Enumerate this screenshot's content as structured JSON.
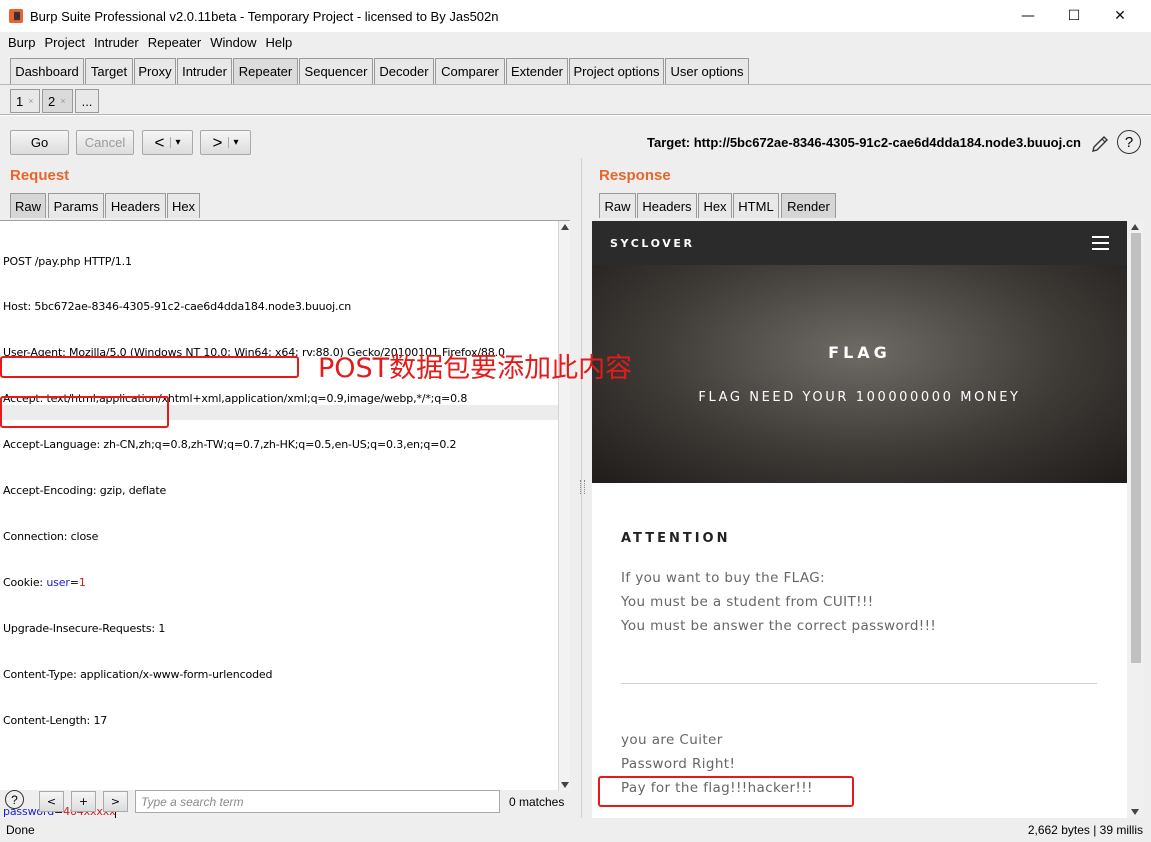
{
  "window": {
    "title": "Burp Suite Professional v2.0.11beta - Temporary Project - licensed to By Jas502n",
    "minimize": "—",
    "maximize": "☐",
    "close": "✕"
  },
  "menu": [
    "Burp",
    "Project",
    "Intruder",
    "Repeater",
    "Window",
    "Help"
  ],
  "main_tabs": [
    "Dashboard",
    "Target",
    "Proxy",
    "Intruder",
    "Repeater",
    "Sequencer",
    "Decoder",
    "Comparer",
    "Extender",
    "Project options",
    "User options"
  ],
  "active_main_tab": "Repeater",
  "sub_tabs": {
    "tab1": "1",
    "tab2": "2",
    "more": "...",
    "close_glyph": "×"
  },
  "toolbar": {
    "go": "Go",
    "cancel": "Cancel",
    "back": "<",
    "back_drop": "▾",
    "forward": ">",
    "forward_drop": "▾",
    "target": "Target: http://5bc672ae-8346-4305-91c2-cae6d4dda184.node3.buuoj.cn",
    "help": "?"
  },
  "request": {
    "title": "Request",
    "tabs": [
      "Raw",
      "Params",
      "Headers",
      "Hex"
    ],
    "active_tab": "Raw",
    "lines": {
      "l1": "POST /pay.php HTTP/1.1",
      "l2": "Host: 5bc672ae-8346-4305-91c2-cae6d4dda184.node3.buuoj.cn",
      "l3": "User-Agent: Mozilla/5.0 (Windows NT 10.0; Win64; x64; rv:88.0) Gecko/20100101 Firefox/88.0",
      "l4": "Accept: text/html,application/xhtml+xml,application/xml;q=0.9,image/webp,*/*;q=0.8",
      "l5": "Accept-Language: zh-CN,zh;q=0.8,zh-TW;q=0.7,zh-HK;q=0.5,en-US;q=0.3,en;q=0.2",
      "l6": "Accept-Encoding: gzip, deflate",
      "l7": "Connection: close",
      "l8_key": "Cookie: ",
      "l8_name": "user",
      "l8_eq": "=",
      "l8_val": "1",
      "l9": "Upgrade-Insecure-Requests: 1",
      "l10": "Content-Type: application/x-www-form-urlencoded",
      "l11": "Content-Length: 17",
      "l12": "",
      "l13_name": "password",
      "l13_eq": "=",
      "l13_val": "404xxxxx"
    }
  },
  "search": {
    "help": "?",
    "prev": "<",
    "add": "+",
    "next": ">",
    "placeholder": "Type a search term",
    "matches": "0 matches"
  },
  "response": {
    "title": "Response",
    "tabs": [
      "Raw",
      "Headers",
      "Hex",
      "HTML",
      "Render"
    ],
    "active_tab": "Render",
    "page": {
      "brand": "SYCLOVER",
      "hero_title": "FLAG",
      "hero_sub": "FLAG NEED YOUR 100000000 MONEY",
      "attention": "ATTENTION",
      "p1": "If you want to buy the FLAG:",
      "p2": "You must be a student from CUIT!!!",
      "p3": "You must be answer the correct password!!!",
      "r1": "you are Cuiter",
      "r2": "Password Right!",
      "r3": "Pay for the flag!!!hacker!!!"
    }
  },
  "annotation": {
    "text": "POST数据包要添加此内容",
    "color": "#e51b1b"
  },
  "status": {
    "left": "Done",
    "right": "2,662 bytes | 39 millis"
  },
  "colors": {
    "accent": "#e8662b",
    "keyword": "#1c1cd1",
    "value": "#cc1c1c"
  }
}
